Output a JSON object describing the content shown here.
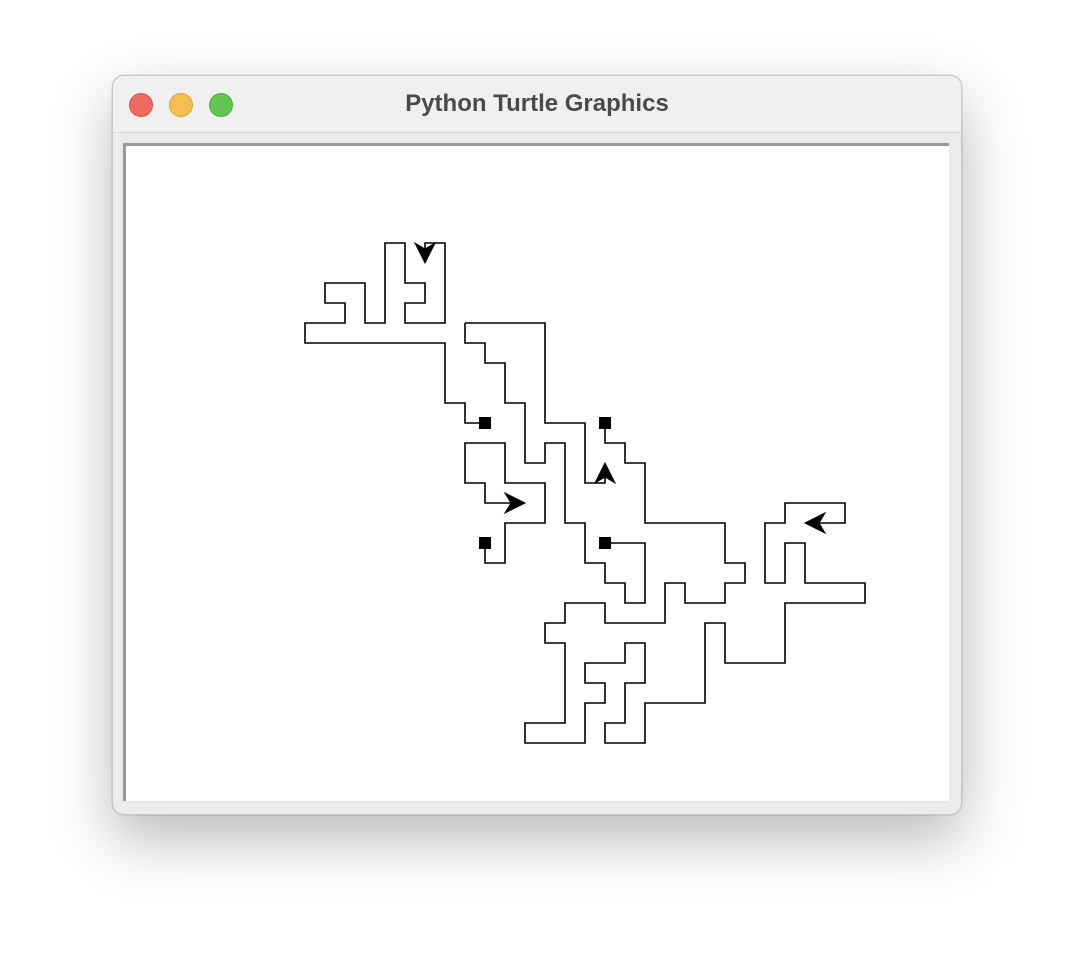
{
  "window": {
    "title": "Python Turtle Graphics"
  },
  "colors": {
    "pen": "#000000",
    "canvas_bg": "#ffffff",
    "close_button": "#ee6a5f",
    "minimize_button": "#f5bf4f",
    "zoom_button": "#62c554"
  },
  "turtles": {
    "count": 4,
    "headings": [
      "down",
      "up",
      "right",
      "left"
    ]
  },
  "stamps": {
    "count": 4
  }
}
